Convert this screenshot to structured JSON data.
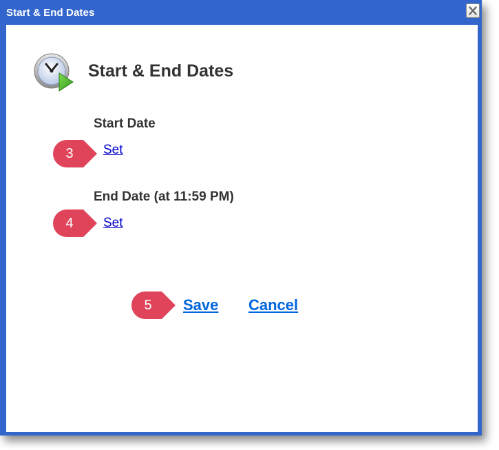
{
  "window": {
    "title": "Start & End Dates"
  },
  "dialog": {
    "heading": "Start & End Dates",
    "start_date": {
      "label": "Start Date",
      "link": "Set",
      "callout": "3"
    },
    "end_date": {
      "label": "End Date (at 11:59 PM)",
      "link": "Set",
      "callout": "4"
    },
    "actions": {
      "save": "Save",
      "cancel": "Cancel",
      "callout": "5"
    }
  },
  "colors": {
    "window_border": "#3366cc",
    "link": "#0000cc",
    "action_link": "#0066dd",
    "callout": "#e0445a"
  },
  "icons": {
    "header": "clock-play-icon",
    "close": "close-icon"
  }
}
